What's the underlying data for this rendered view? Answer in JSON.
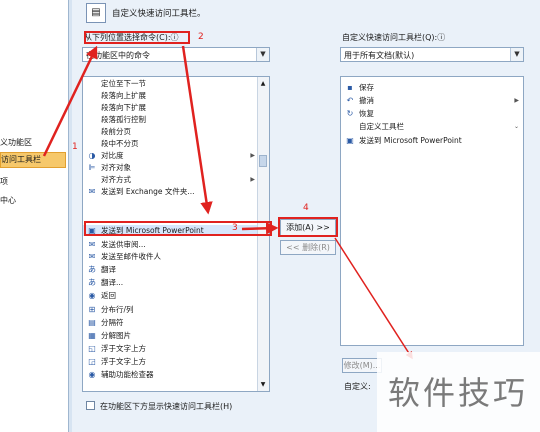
{
  "colors": {
    "accent": "#e0221f",
    "selected": "#f6c86b",
    "panel": "#eaf1f9"
  },
  "left_nav": {
    "items": [
      {
        "label": "义功能区",
        "selected": false
      },
      {
        "label": "访问工具栏",
        "selected": true
      },
      {
        "label": "项",
        "selected": false
      },
      {
        "label": "中心",
        "selected": false
      }
    ]
  },
  "header": {
    "title": "自定义快速访问工具栏。",
    "icon": "toolbar-icon"
  },
  "left_pane": {
    "choose_label": "从下列位置选择命令(C):",
    "choose_info": "ⓘ",
    "choose_value": "在功能区中的命令",
    "commands": [
      {
        "label": "定位至下一节",
        "icon": "",
        "submenu": false
      },
      {
        "label": "段落向上扩展",
        "icon": "",
        "submenu": false
      },
      {
        "label": "段落向下扩展",
        "icon": "",
        "submenu": false
      },
      {
        "label": "段落孤行控制",
        "icon": "",
        "submenu": false
      },
      {
        "label": "段前分页",
        "icon": "",
        "submenu": false
      },
      {
        "label": "段中不分页",
        "icon": "",
        "submenu": false
      },
      {
        "label": "对比度",
        "icon": "◑",
        "submenu": true
      },
      {
        "label": "对齐对象",
        "icon": "⊫",
        "submenu": false
      },
      {
        "label": "对齐方式",
        "icon": "",
        "submenu": true
      },
      {
        "label": "发送到 Exchange 文件夹...",
        "icon": "✉",
        "submenu": false
      },
      {
        "label": "发送到 Microsoft PowerPoint",
        "icon": "▣",
        "submenu": false,
        "highlight": true
      },
      {
        "label": "发送供审阅...",
        "icon": "✉",
        "submenu": false
      },
      {
        "label": "发送至邮件收件人",
        "icon": "✉",
        "submenu": false
      },
      {
        "label": "翻译",
        "icon": "あ",
        "submenu": false
      },
      {
        "label": "翻译...",
        "icon": "あ",
        "submenu": false
      },
      {
        "label": "返回",
        "icon": "◉",
        "submenu": false
      },
      {
        "label": "分布行/列",
        "icon": "⊞",
        "submenu": false
      },
      {
        "label": "分隔符",
        "icon": "▤",
        "submenu": false
      },
      {
        "label": "分解图片",
        "icon": "▦",
        "submenu": false
      },
      {
        "label": "浮于文字上方",
        "icon": "◱",
        "submenu": false
      },
      {
        "label": "浮于文字上方",
        "icon": "◲",
        "submenu": false
      },
      {
        "label": "辅助功能检查器",
        "icon": "◉",
        "submenu": false
      }
    ],
    "show_below_label": "在功能区下方显示快速访问工具栏(H)"
  },
  "middle": {
    "add_label": "添加(A) >>",
    "remove_label": "<< 删除(R)"
  },
  "right_pane": {
    "customize_label": "自定义快速访问工具栏(Q):",
    "customize_info": "ⓘ",
    "scope_value": "用于所有文档(默认)",
    "commands": [
      {
        "label": "保存",
        "icon": "💾",
        "submenu": false
      },
      {
        "label": "撤消",
        "icon": "↶",
        "submenu": true
      },
      {
        "label": "恢复",
        "icon": "↻",
        "submenu": false
      },
      {
        "label": "自定义工具栏",
        "icon": "",
        "submenu": false
      },
      {
        "label": "发送到 Microsoft PowerPoint",
        "icon": "▣",
        "submenu": false
      }
    ],
    "modify_label": "修改(M)...",
    "custom_label": "自定义:"
  },
  "annotations": {
    "step1": "1",
    "step2": "2",
    "step3": "3",
    "step4": "4"
  },
  "watermark": "软件技巧"
}
